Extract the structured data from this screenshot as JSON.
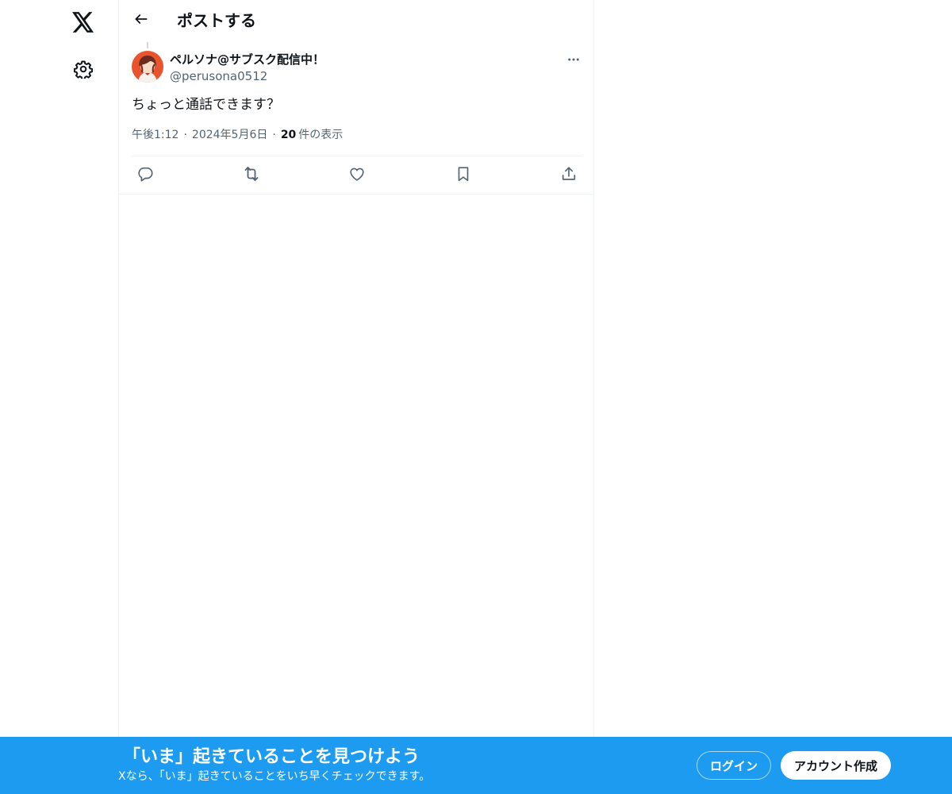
{
  "nav": {
    "logo_icon": "x-logo-icon",
    "settings_icon": "gear-icon"
  },
  "header": {
    "title": "ポストする",
    "back_icon": "arrow-left-icon"
  },
  "post": {
    "author_name": "ペルソナ@サブスク配信中！",
    "author_handle": "@perusona0512",
    "text": "ちょっと通話できます？",
    "time": "午後1:12",
    "date": "2024年5月6日",
    "views_count": "20",
    "views_label": "件の表示",
    "separator": "·",
    "actions": [
      "reply-icon",
      "repost-icon",
      "like-icon",
      "bookmark-icon",
      "share-icon"
    ]
  },
  "banner": {
    "title": "「いま」起きていることを見つけよう",
    "subtitle": "Xなら、「いま」起きていることをいち早くチェックできます。",
    "login_label": "ログイン",
    "signup_label": "アカウント作成"
  },
  "colors": {
    "accent": "#1d9bf0",
    "text_primary": "#0f1419",
    "text_secondary": "#536471",
    "border": "#eff3f4"
  }
}
